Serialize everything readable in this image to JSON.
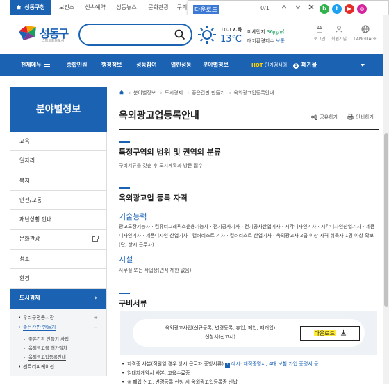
{
  "topbar": {
    "tabs": [
      "성동구청",
      "보건소",
      "신속예약",
      "성동뉴스",
      "문화관광",
      "구의"
    ]
  },
  "findbar": {
    "query": "다운로드",
    "count": "0/1"
  },
  "header": {
    "logo_name": "성동구",
    "logo_slogan": "스마트포용도시",
    "search_placeholder": "",
    "weather": {
      "date": "10.17.화",
      "temp": "13℃",
      "air1_label": "미세먼지",
      "air1_value": "36㎍/㎥",
      "air2_label": "대기환경지수",
      "air2_value": "보통"
    },
    "utils": [
      "로그인",
      "회원가입",
      "LANGUAGE"
    ]
  },
  "nav": {
    "all": "전체메뉴",
    "items": [
      "종합민원",
      "행정정보",
      "성동참여",
      "열린성동",
      "분야별정보"
    ],
    "hot_label": "HOT",
    "hot_word": "인기검색어",
    "keyword_rank": "1",
    "keyword": "폐기물"
  },
  "sidebar": {
    "title": "분야별정보",
    "items": [
      "교육",
      "일자리",
      "복지",
      "안전/교통",
      "재난상황 안내",
      "문화관광",
      "청소",
      "환경"
    ],
    "active": "도시경제",
    "sub": [
      {
        "label": "우리구전통시장",
        "toggle": "+"
      },
      {
        "label": "좋은간판 만들기",
        "toggle": "−"
      }
    ],
    "sub2": [
      "좋은간판 만들기 사업",
      "옥외광고물 허가절차",
      "옥외광고업등록안내"
    ],
    "sub_next": "센트리피케이션"
  },
  "content": {
    "breadcrumb": [
      "분야별정보",
      "도시경제",
      "좋은간판 만들기",
      "옥외광고업등록안내"
    ],
    "title": "옥외광고업등록안내",
    "tools": [
      "공유하기",
      "인쇄하기"
    ],
    "sec1_title": "특정구역의 범위 및 권역의 분류",
    "sec1_text": "구비서류를 갖춘 후 도시계획과 방문 접수",
    "sec2_title": "옥외광고업 등록 자격",
    "sub1_title": "기술능력",
    "sub1_text": "광고도장기능사 · 컴퓨터그래픽스운용기능사 · 전기공사기사 · 전기공사산업기사 · 시각디자인기사 · 시각디자인산업기사 · 제품디자인기사 · 제품디자인 산업기사 · 컬러리스트 기사 · 컬러리스트 산업기사 · 옥외광고사 2급 이상 자격 취득자 1명 이상 확보(단, 상시 근무자)",
    "sub2_title": "시설",
    "sub2_text": "사무실 또는 작업장(면적 제한 없음)",
    "sec3_title": "구비서류",
    "doc_line1": "옥외광고사업(신규등록, 변경등록, 휴업, 폐업, 재개업)",
    "doc_line2": "신청서(신고서)",
    "download_label": "다운로드",
    "bullets": [
      {
        "text": "자격증 사본(직원일 경우 상시 근로자 증빙서류)",
        "note": "예시: 재직증명서, 4대 보험 가입 증명서 등"
      },
      {
        "text": "임대차계약서 사본, 교육수료증",
        "note": ""
      },
      {
        "text": "※ 폐업 신고, 변경등록 신청 시 옥외광고업등록증 반납",
        "note": ""
      }
    ]
  },
  "colors": {
    "brand": "#1b62b3",
    "highlight": "#ffeb3b"
  }
}
